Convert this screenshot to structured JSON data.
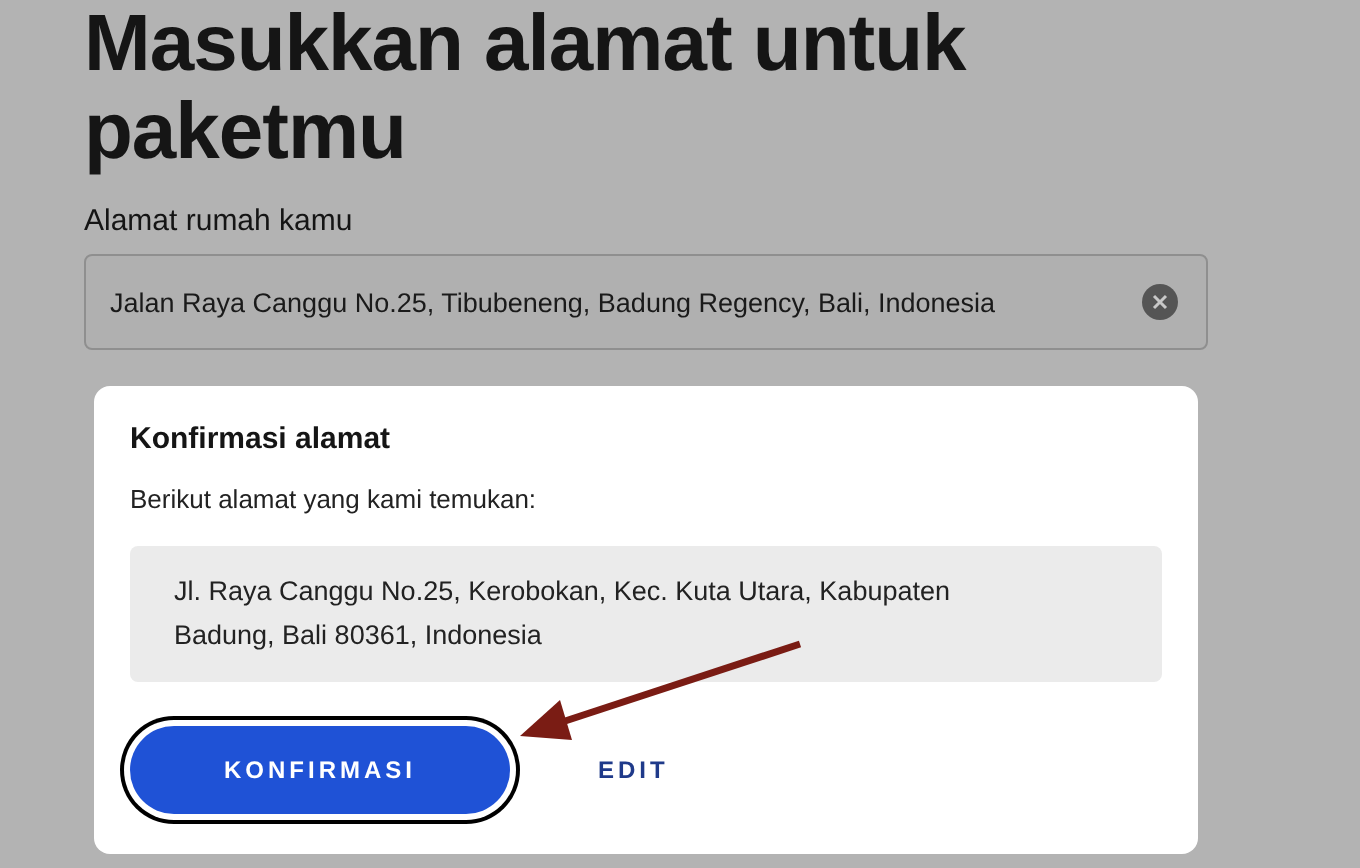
{
  "heading": "Masukkan alamat untuk paketmu",
  "address_field": {
    "label": "Alamat rumah kamu",
    "value": "Jalan Raya Canggu No.25, Tibubeneng, Badung Regency, Bali, Indonesia"
  },
  "dialog": {
    "title": "Konfirmasi alamat",
    "message": "Berikut alamat yang kami temukan:",
    "found_address": "Jl. Raya Canggu No.25, Kerobokan, Kec. Kuta Utara, Kabupaten Badung, Bali 80361, Indonesia",
    "buttons": [
      {
        "label": "KONFIRMASI",
        "kind": "primary",
        "focused": true
      },
      {
        "label": "EDIT",
        "kind": "text"
      }
    ]
  }
}
